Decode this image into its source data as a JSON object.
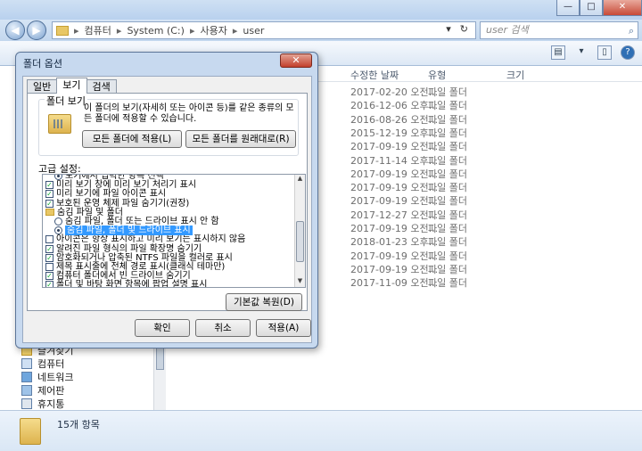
{
  "explorer": {
    "window_buttons": [
      "—",
      "□",
      "✕"
    ],
    "nav": {
      "back_glyph": "◀",
      "forward_glyph": "▶"
    },
    "breadcrumb": [
      "컴퓨터",
      "System (C:)",
      "사용자",
      "user"
    ],
    "breadcrumb_sep": "▸",
    "addr_buttons": [
      "▾",
      "↻"
    ],
    "search_placeholder": "user 검색",
    "search_icon": "search-icon",
    "toolbar_icons": [
      "views-icon",
      "preview-pane-icon",
      "help-icon"
    ],
    "toolbar_glyphs": [
      "▤",
      "▾",
      "▯",
      "?"
    ],
    "columns": {
      "modified": "수정한 날짜",
      "type": "유형",
      "size": "크기"
    },
    "files": [
      {
        "date": "2017-02-20 오전...",
        "type": "파일 폴더"
      },
      {
        "date": "2016-12-06 오후...",
        "type": "파일 폴더"
      },
      {
        "date": "2016-08-26 오전...",
        "type": "파일 폴더"
      },
      {
        "date": "2015-12-19 오후...",
        "type": "파일 폴더"
      },
      {
        "date": "2017-09-19 오전...",
        "type": "파일 폴더"
      },
      {
        "date": "2017-11-14 오후...",
        "type": "파일 폴더"
      },
      {
        "date": "2017-09-19 오전...",
        "type": "파일 폴더"
      },
      {
        "date": "2017-09-19 오전...",
        "type": "파일 폴더"
      },
      {
        "date": "2017-09-19 오전...",
        "type": "파일 폴더"
      },
      {
        "date": "2017-12-27 오전...",
        "type": "파일 폴더"
      },
      {
        "date": "2017-09-19 오전...",
        "type": "파일 폴더"
      },
      {
        "date": "2018-01-23 오후...",
        "type": "파일 폴더"
      },
      {
        "date": "2017-09-19 오전...",
        "type": "파일 폴더"
      },
      {
        "date": "2017-09-19 오전...",
        "type": "파일 폴더"
      },
      {
        "date": "2017-11-09 오전...",
        "type": "파일 폴더"
      }
    ],
    "nav_tree": [
      "즐겨찾기",
      "컴퓨터",
      "네트워크",
      "제어판",
      "휴지통"
    ],
    "status": "15개 항목"
  },
  "dialog": {
    "title": "폴더 옵션",
    "close_glyph": "✕",
    "tabs": [
      "일반",
      "보기",
      "검색"
    ],
    "active_tab": "보기",
    "folder_views": {
      "label": "폴더 보기",
      "description": "이 폴더의 보기(자세히 또는 아이콘 등)를 같은 종류의 모든 폴더에 적용할 수 있습니다.",
      "apply_button": "모든 폴더에 적용(L)",
      "reset_button": "모든 폴더를 원래대로(R)"
    },
    "advanced_label": "고급 설정:",
    "advanced_items": [
      {
        "kind": "radio",
        "checked": true,
        "indent": 1,
        "label": "보기에서 입력한 항목 선택"
      },
      {
        "kind": "check",
        "checked": true,
        "indent": 0,
        "label": "미리 보기 창에 미리 보기 처리기 표시"
      },
      {
        "kind": "check",
        "checked": true,
        "indent": 0,
        "label": "미리 보기에 파일 아이콘 표시"
      },
      {
        "kind": "check",
        "checked": true,
        "indent": 0,
        "label": "보호된 운영 체제 파일 숨기기(권장)"
      },
      {
        "kind": "folder",
        "checked": false,
        "indent": 0,
        "label": "숨김 파일 및 폴더"
      },
      {
        "kind": "radio",
        "checked": false,
        "indent": 1,
        "label": "숨김 파일, 폴더 또는 드라이브 표시 안 함"
      },
      {
        "kind": "radio",
        "checked": true,
        "indent": 1,
        "label": "숨김 파일, 폴더 및 드라이브 표시",
        "selected": true
      },
      {
        "kind": "check",
        "checked": false,
        "indent": 0,
        "label": "아이콘은 항상 표시하고 미리 보기는 표시하지 않음"
      },
      {
        "kind": "check",
        "checked": true,
        "indent": 0,
        "label": "알려진 파일 형식의 파일 확장명 숨기기"
      },
      {
        "kind": "check",
        "checked": true,
        "indent": 0,
        "label": "암호화되거나 압축된 NTFS 파일을 컬러로 표시"
      },
      {
        "kind": "check",
        "checked": false,
        "indent": 0,
        "label": "제목 표시줄에 전체 경로 표시(클래식 테마만)"
      },
      {
        "kind": "check",
        "checked": true,
        "indent": 0,
        "label": "컴퓨터 폴더에서 빈 드라이브 숨기기"
      },
      {
        "kind": "check",
        "checked": true,
        "indent": 0,
        "label": "폴더 및 바탕 화면 항목에 팝업 설명 표시"
      }
    ],
    "restore_defaults": "기본값 복원(D)",
    "ok": "확인",
    "cancel": "취소",
    "apply": "적용(A)"
  }
}
